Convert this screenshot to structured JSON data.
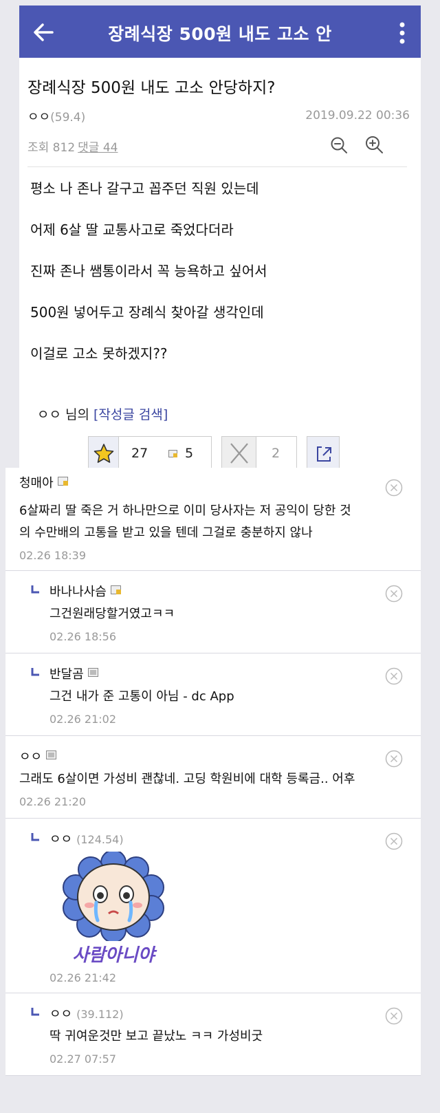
{
  "appbar": {
    "title": "장례식장 500원 내도 고소 안"
  },
  "post": {
    "title": "장례식장 500원 내도 고소 안당하지?",
    "author": "ㅇㅇ",
    "author_score": "(59.4)",
    "date": "2019.09.22 00:36",
    "views_label": "조회 812",
    "comments_label": "댓글 44",
    "body": [
      "평소 나 존나 갈구고 꼽주던 직원 있는데",
      "어제 6살 딸 교통사고로 죽었다더라",
      "진짜 존나 쌤통이라서 꼭 능욕하고 싶어서",
      "500원 넣어두고 장례식 찾아갈 생각인데",
      "이걸로 고소 못하겠지??"
    ],
    "by_author": "ㅇㅇ 님의",
    "search_link": "[작성글 검색]",
    "upvotes": "27",
    "fixed_upvotes": "5",
    "downvotes": "2"
  },
  "comments": [
    {
      "name": "청매아",
      "text": [
        "6살짜리 딸 죽은 거 하나만으로 이미 당사자는 저 공익이 당한 것",
        "의 수만배의 고통을 받고 있을 텐데 그걸로 충분하지 않나"
      ],
      "date": "02.26 18:39"
    },
    {
      "name": "바나나사슴",
      "text": [
        "그건원래당할거였고ㅋㅋ"
      ],
      "date": "02.26 18:56"
    },
    {
      "name": "반달곰",
      "text": [
        "그건 내가 준 고통이 아님 - dc App"
      ],
      "date": "02.26 21:02"
    },
    {
      "name": "ㅇㅇ",
      "text": [
        "그래도 6살이면 가성비 괜찮네. 고딩 학원비에 대학 등록금.. 어후"
      ],
      "date": "02.26 21:20"
    },
    {
      "name": "ㅇㅇ",
      "score": "(124.54)",
      "sticker_text": "사람아니야",
      "date": "02.26 21:42"
    },
    {
      "name": "ㅇㅇ",
      "score": "(39.112)",
      "text": [
        "딱 귀여운것만 보고 끝났노 ㅋㅋ 가성비굿"
      ],
      "date": "02.27 07:57"
    }
  ],
  "colors": {
    "appbar": "#4b57b3",
    "link": "#3a45a0",
    "muted": "#999999"
  }
}
